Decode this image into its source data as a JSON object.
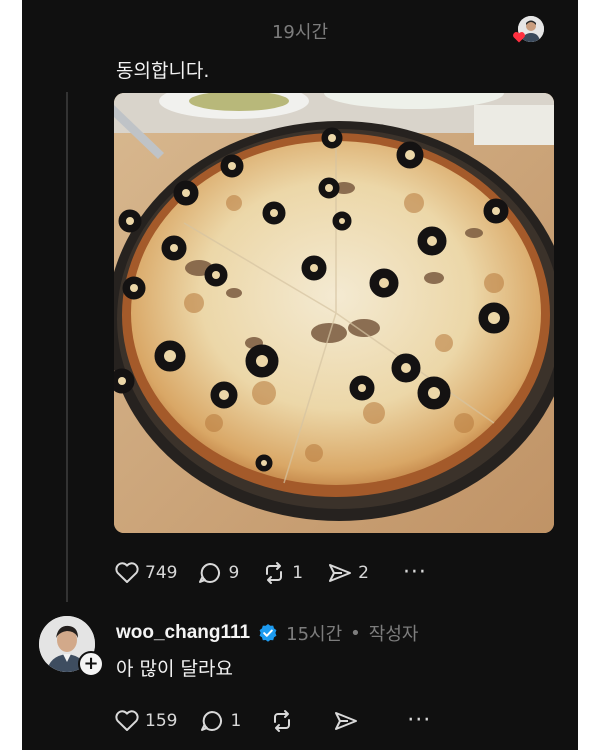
{
  "post": {
    "time": "19시간",
    "text": "동의합니다.",
    "likes": "749",
    "comments": "9",
    "reposts": "1",
    "shares": "2"
  },
  "reply": {
    "username": "woo_chang111",
    "time": "15시간",
    "separator": "•",
    "author_tag": "작성자",
    "text": "아 많이 달라요",
    "likes": "159",
    "comments": "1"
  },
  "colors": {
    "background": "#101010",
    "text": "#f2f2f2",
    "muted": "#7d7d7d",
    "verified": "#1d9bf0",
    "heart": "#ff3040"
  }
}
